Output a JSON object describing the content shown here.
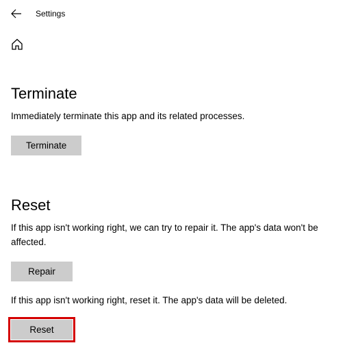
{
  "header": {
    "title": "Settings"
  },
  "sections": {
    "terminate": {
      "heading": "Terminate",
      "description": "Immediately terminate this app and its related processes.",
      "button_label": "Terminate"
    },
    "reset": {
      "heading": "Reset",
      "repair_description": "If this app isn't working right, we can try to repair it. The app's data won't be affected.",
      "repair_button_label": "Repair",
      "reset_description": "If this app isn't working right, reset it. The app's data will be deleted.",
      "reset_button_label": "Reset"
    }
  }
}
